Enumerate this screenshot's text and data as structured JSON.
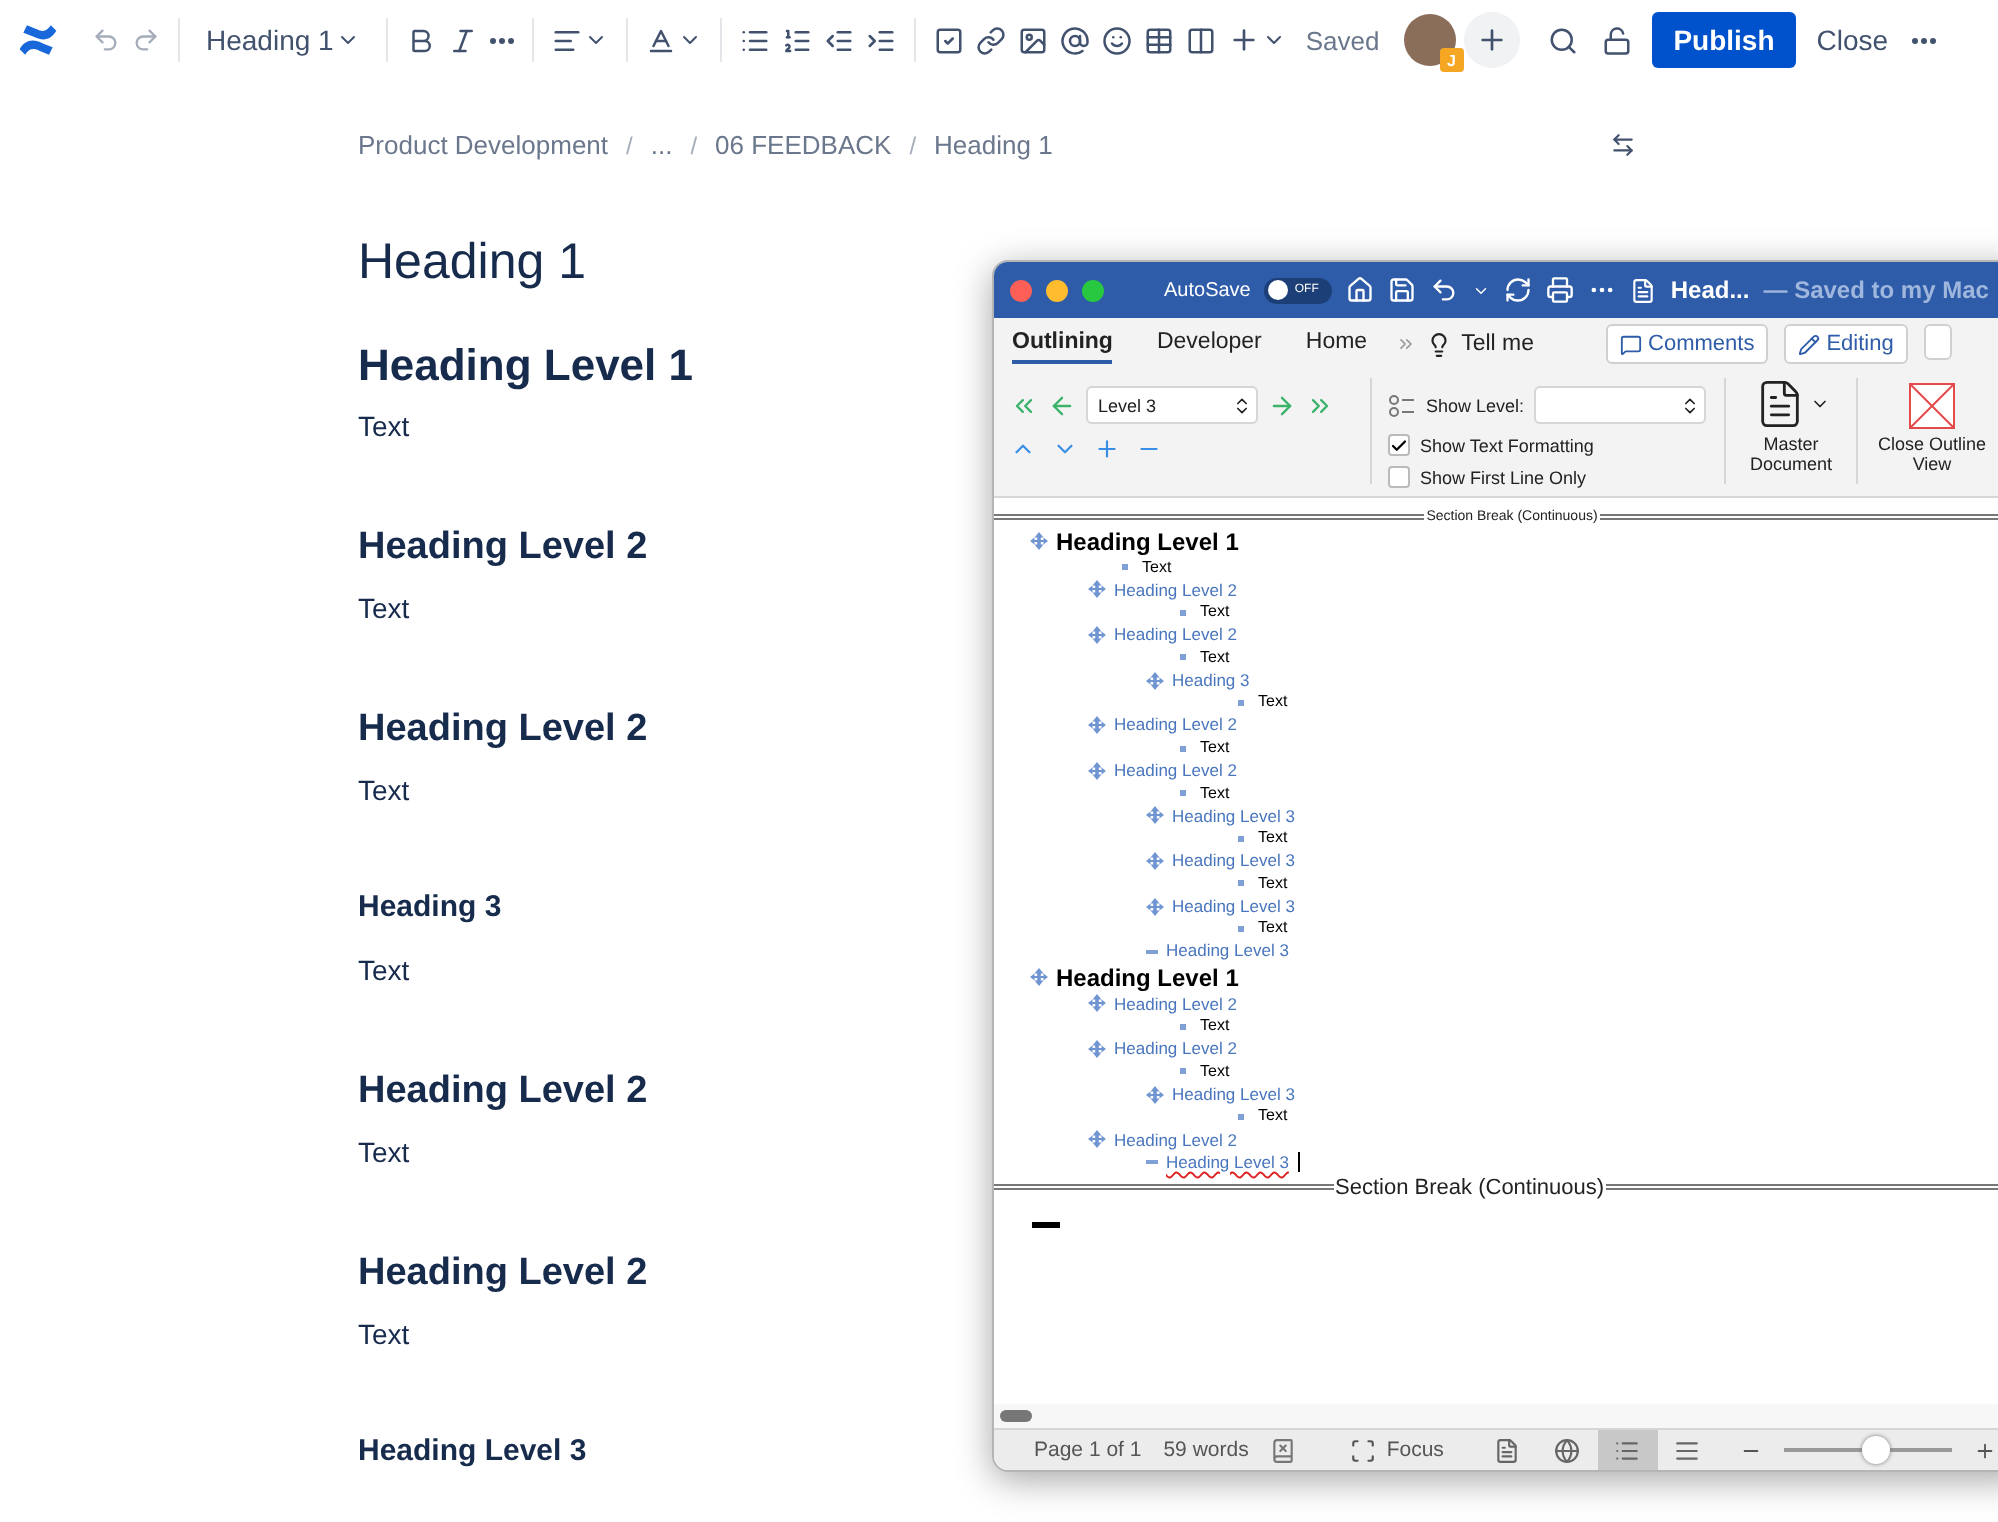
{
  "toolbar": {
    "style_menu": "Heading 1",
    "status": "Saved",
    "avatar_badge": "J",
    "publish": "Publish",
    "close": "Close"
  },
  "breadcrumbs": [
    {
      "kind": "link",
      "text": "Product Development"
    },
    {
      "kind": "separator",
      "text": "/"
    },
    {
      "kind": "link",
      "text": "..."
    },
    {
      "kind": "separator",
      "text": "/"
    },
    {
      "kind": "link",
      "text": "06 FEEDBACK"
    },
    {
      "kind": "separator",
      "text": "/"
    },
    {
      "kind": "link",
      "text": "Heading 1"
    }
  ],
  "page": [
    {
      "kind": "title",
      "text": "Heading 1"
    },
    {
      "kind": "h1",
      "text": "Heading Level 1"
    },
    {
      "kind": "text",
      "text": "Text"
    },
    {
      "kind": "h2",
      "text": "Heading Level 2"
    },
    {
      "kind": "text",
      "text": "Text"
    },
    {
      "kind": "h2",
      "text": "Heading Level 2"
    },
    {
      "kind": "text",
      "text": "Text"
    },
    {
      "kind": "h3",
      "text": "Heading 3"
    },
    {
      "kind": "text",
      "text": "Text"
    },
    {
      "kind": "h2",
      "text": "Heading Level 2"
    },
    {
      "kind": "text",
      "text": "Text"
    },
    {
      "kind": "h2",
      "text": "Heading Level 2"
    },
    {
      "kind": "text",
      "text": "Text"
    },
    {
      "kind": "h3",
      "text": "Heading Level 3"
    }
  ],
  "word": {
    "autosave": {
      "label": "AutoSave",
      "on": false,
      "state_text": "OFF"
    },
    "title": "Head...",
    "save_status": "— Saved to my Mac",
    "tabs": [
      {
        "label": "Outlining",
        "selected": true
      },
      {
        "label": "Developer",
        "selected": false
      },
      {
        "label": "Home",
        "selected": false
      }
    ],
    "tell_me": "Tell me",
    "comments": "Comments",
    "editing": "Editing",
    "level_select": "Level 3",
    "show_level_label": "Show Level:",
    "options": [
      {
        "label": "Show Text Formatting",
        "checked": true
      },
      {
        "label": "Show First Line Only",
        "checked": false
      }
    ],
    "master_document": "Master Document",
    "close_outline": "Close Outline View",
    "section_breaks": [
      "Section Break (Continuous)",
      "Section Break (Continuous)"
    ],
    "outline": [
      {
        "kind": "h1",
        "text": "Heading Level 1",
        "children": [
          {
            "kind": "body",
            "text": "Text"
          },
          {
            "kind": "h2",
            "text": "Heading Level 2",
            "children": [
              {
                "kind": "body",
                "text": "Text"
              }
            ]
          },
          {
            "kind": "h2",
            "text": "Heading Level 2",
            "children": [
              {
                "kind": "body",
                "text": "Text"
              },
              {
                "kind": "h3",
                "text": "Heading 3",
                "children": [
                  {
                    "kind": "body",
                    "text": "Text"
                  }
                ]
              }
            ]
          },
          {
            "kind": "h2",
            "text": "Heading Level 2",
            "children": [
              {
                "kind": "body",
                "text": "Text"
              }
            ]
          },
          {
            "kind": "h2",
            "text": "Heading Level 2",
            "children": [
              {
                "kind": "body",
                "text": "Text"
              },
              {
                "kind": "h3",
                "text": "Heading Level 3",
                "children": [
                  {
                    "kind": "body",
                    "text": "Text"
                  }
                ]
              },
              {
                "kind": "h3",
                "text": "Heading Level 3",
                "children": [
                  {
                    "kind": "body",
                    "text": "Text"
                  }
                ]
              },
              {
                "kind": "h3",
                "text": "Heading Level 3",
                "children": [
                  {
                    "kind": "body",
                    "text": "Text"
                  }
                ]
              },
              {
                "kind": "h3",
                "text": "Heading Level 3"
              }
            ]
          }
        ]
      },
      {
        "kind": "h1",
        "text": "Heading Level 1",
        "children": [
          {
            "kind": "h2",
            "text": "Heading Level 2",
            "children": [
              {
                "kind": "body",
                "text": "Text"
              }
            ]
          },
          {
            "kind": "h2",
            "text": "Heading Level 2",
            "children": [
              {
                "kind": "body",
                "text": "Text"
              },
              {
                "kind": "h3",
                "text": "Heading Level 3",
                "children": [
                  {
                    "kind": "body",
                    "text": "Text"
                  }
                ]
              }
            ]
          },
          {
            "kind": "h2",
            "text": "Heading Level 2",
            "children": [
              {
                "kind": "h3",
                "text": "Heading Level 3",
                "spell_error": true,
                "cursor": true
              }
            ]
          }
        ]
      }
    ],
    "status_bar": {
      "page": "Page 1 of 1",
      "words": "59 words",
      "focus": "Focus",
      "views": [
        {
          "kind": "print",
          "selected": false
        },
        {
          "kind": "web",
          "selected": false
        },
        {
          "kind": "outline",
          "selected": true
        },
        {
          "kind": "draft",
          "selected": false
        }
      ],
      "zoom": {
        "level": 0.55
      }
    }
  }
}
